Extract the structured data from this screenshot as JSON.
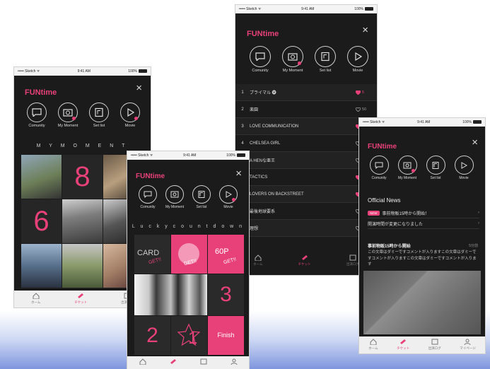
{
  "colors": {
    "accent": "#e8417a",
    "panel": "#1b1b1b"
  },
  "status": {
    "carrier": "••••• Sketch ᯤ",
    "time": "9:41 AM",
    "battery": "100%"
  },
  "app": {
    "logo": "FUNtime",
    "close": "×"
  },
  "nav_icons": [
    {
      "label": "Comunity",
      "icon": "chat-bubble-icon",
      "badge": false
    },
    {
      "label": "My Moment",
      "icon": "camera-icon",
      "badge": true
    },
    {
      "label": "Set list",
      "icon": "music-list-icon",
      "badge": false
    },
    {
      "label": "Movie",
      "icon": "play-icon",
      "badge": true
    }
  ],
  "tabs": [
    {
      "label": "ホーム",
      "icon": "home-icon"
    },
    {
      "label": "チケット",
      "icon": "ticket-icon"
    },
    {
      "label": "出演ログ",
      "icon": "calendar-icon"
    },
    {
      "label": "マイページ",
      "icon": "person-icon"
    }
  ],
  "moment": {
    "heading": "M Y   M O M E N T",
    "tiles": [
      "8",
      "6"
    ]
  },
  "lucky": {
    "heading": "L u c k y   c o u n t d o w n",
    "tiles": [
      "CARD",
      "GET!!",
      "GET!!",
      "60P",
      "GET!!",
      "3",
      "2",
      "1",
      "Finish"
    ]
  },
  "setlist": [
    {
      "num": "1",
      "title": "プライマル 🅜",
      "likes": "5",
      "liked": true
    },
    {
      "num": "2",
      "title": "楽園",
      "likes": "50",
      "liked": false
    },
    {
      "num": "3",
      "title": "LOVE COMMUNICATION",
      "likes": "120",
      "liked": true
    },
    {
      "num": "4",
      "title": "CHELSEA GIRL",
      "likes": "15",
      "liked": false
    },
    {
      "num": "5",
      "title": "A HENな亜王",
      "likes": "15",
      "liked": false
    },
    {
      "num": "6",
      "title": "TACTICS",
      "likes": "50",
      "liked": true
    },
    {
      "num": "7",
      "title": "LOVERS ON BACKSTREET",
      "likes": "50",
      "liked": true
    },
    {
      "num": "8",
      "title": "最後地球要系",
      "likes": "50",
      "liked": false
    },
    {
      "num": "9",
      "title": "理想",
      "likes": "50",
      "liked": false
    }
  ],
  "news": {
    "heading": "Official News",
    "new_badge": "NEW",
    "items": [
      "事前物販15時から開始！",
      "開演時間が変更になりました"
    ],
    "article_title": "事前物販15時から開始",
    "article_date": "5分前",
    "article_body": "この文章はダミーですコメントが入りますこの文章はダミーですコメントが入りますこの文章はダミーですコメントが入ります"
  }
}
